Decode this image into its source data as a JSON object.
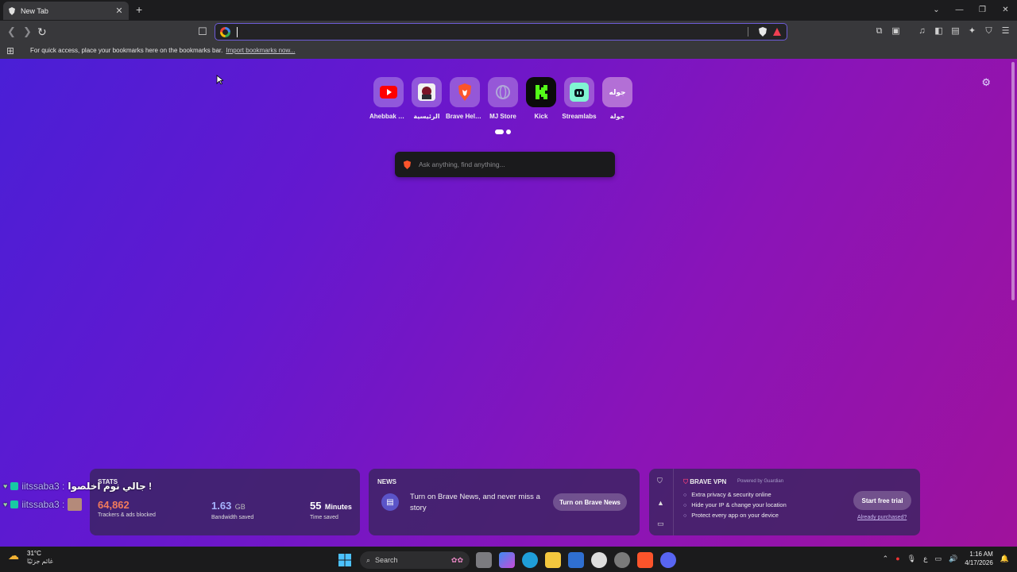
{
  "browser": {
    "tab": {
      "title": "New Tab"
    },
    "url": {
      "value": "",
      "placeholder": ""
    },
    "bookmarks_bar": {
      "message": "For quick access, place your bookmarks here on the bookmarks bar.",
      "import_link": "Import bookmarks now..."
    }
  },
  "new_tab": {
    "top_sites": [
      {
        "label": "Ahebbak Leh",
        "icon": "youtube-icon",
        "color": "#ff0000"
      },
      {
        "label": "الرئيسية",
        "icon": "avatar-icon",
        "color": "#ffffff"
      },
      {
        "label": "Brave Help...",
        "icon": "brave-lion-icon",
        "color": "#fb542b"
      },
      {
        "label": "MJ Store",
        "icon": "globe-icon",
        "color": "#9a90c8"
      },
      {
        "label": "Kick",
        "icon": "kick-icon",
        "color": "#53fc18"
      },
      {
        "label": "Streamlabs",
        "icon": "streamlabs-icon",
        "color": "#80f5d2"
      },
      {
        "label": "جولة",
        "icon": "text-logo-icon",
        "color": "#b36fd6",
        "tile_text": "جوله"
      }
    ],
    "search": {
      "placeholder": "Ask anything, find anything..."
    },
    "stats": {
      "header": "STATS",
      "trackers": {
        "value": "64,862",
        "desc": "Trackers & ads blocked",
        "color": "#f27b5b"
      },
      "bandwidth": {
        "value": "1.63",
        "unit": "GB",
        "desc": "Bandwidth saved",
        "color": "#a7b4ff"
      },
      "time": {
        "value": "55",
        "unit": "Minutes",
        "desc": "Time saved",
        "color": "#ffffff"
      }
    },
    "news": {
      "header": "NEWS",
      "text": "Turn on Brave News, and never miss a story",
      "button": "Turn on Brave News"
    },
    "vpn": {
      "header": "BRAVE VPN",
      "powered": "Powered by Guardian",
      "features": [
        "Extra privacy & security online",
        "Hide your IP & change your location",
        "Protect every app on your device"
      ],
      "trial_button": "Start free trial",
      "purchased_link": "Already purchased?"
    }
  },
  "chat_overlay": [
    {
      "user": "iitssaba3 :",
      "message": "جالي نوم اخلصوا !"
    },
    {
      "user": "iitssaba3 :",
      "message": ""
    }
  ],
  "taskbar": {
    "weather_temp": "31°C",
    "weather_desc": "غائم جزئيًا",
    "search_label": "Search",
    "time": "1:16 AM",
    "date": "4/17/2026",
    "lang": "ع"
  }
}
